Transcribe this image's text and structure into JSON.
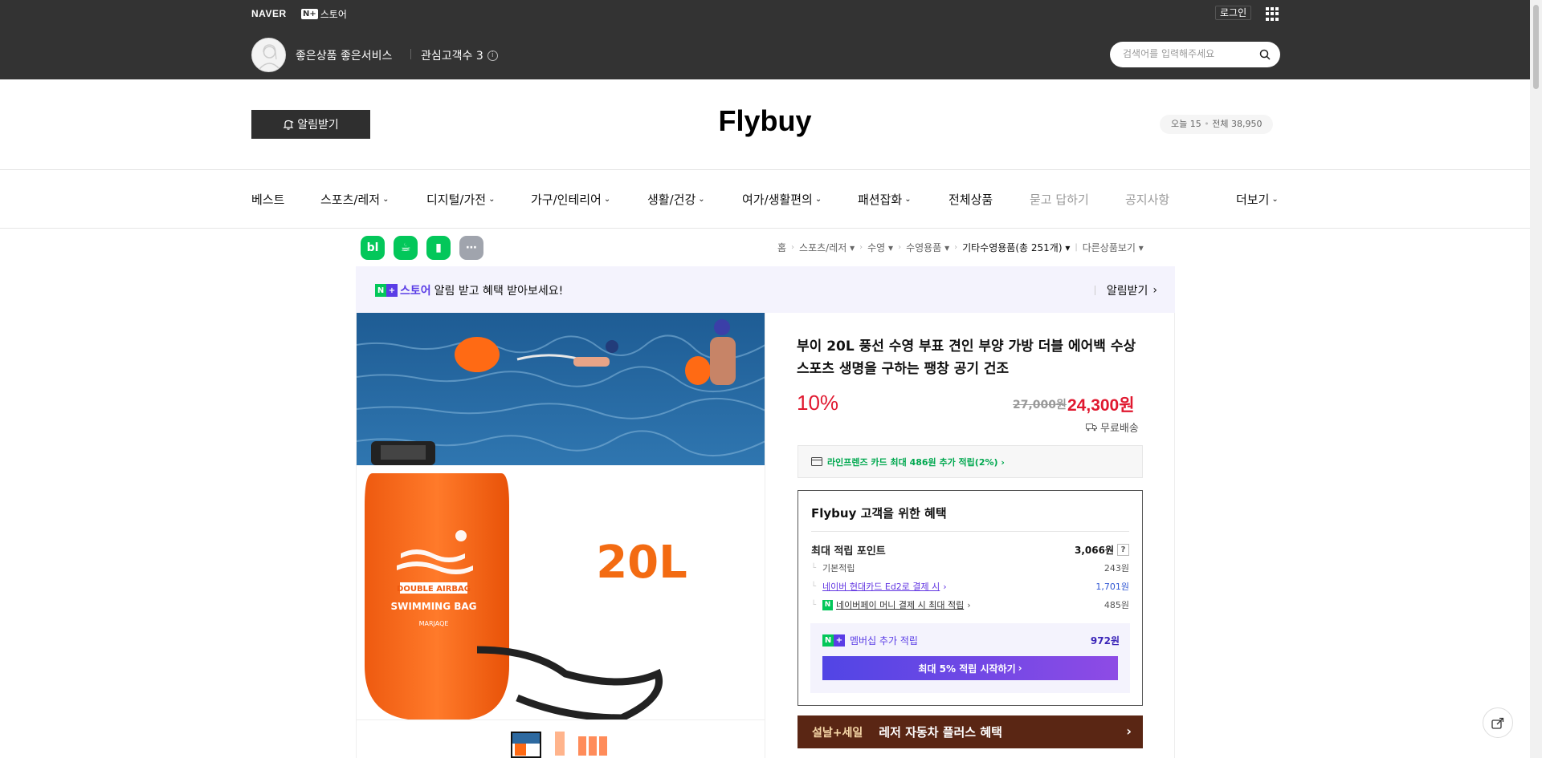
{
  "header": {
    "naver_logo": "NAVER",
    "nplus_badge": "N+",
    "nplus_store_label": "스토어",
    "login_label": "로그인",
    "store_tagline": "좋은상품 좋은서비스",
    "follower_label": "관심고객수 3",
    "search_placeholder": "검색어를 입력해주세요"
  },
  "store": {
    "alarm_label": "알림받기",
    "title": "Flybuy",
    "visit_today": "오늘 15",
    "visit_total": "전체 38,950"
  },
  "nav": {
    "items": [
      {
        "label": "베스트"
      },
      {
        "label": "스포츠/레저"
      },
      {
        "label": "디지털/가전"
      },
      {
        "label": "가구/인테리어"
      },
      {
        "label": "생활/건강"
      },
      {
        "label": "여가/생활편의"
      },
      {
        "label": "패션잡화"
      },
      {
        "label": "전체상품"
      },
      {
        "label": "묻고 답하기"
      },
      {
        "label": "공지사항"
      },
      {
        "label": "더보기"
      }
    ]
  },
  "share": {
    "blog": "bl",
    "cafe": "☕",
    "bookmark": "▮",
    "more": "⋯"
  },
  "breadcrumb": {
    "home": "홈",
    "cat1": "스포츠/레저",
    "cat2": "수영",
    "cat3": "수영용품",
    "cat4": "기타수영용품(총 251개)",
    "other": "다른상품보기"
  },
  "promo": {
    "badge": "N+",
    "store": "스토어",
    "text": "알림 받고 혜택 받아보세요!",
    "cta": "알림받기"
  },
  "product": {
    "title": "부이 20L 풍선 수영 부표 견인 부양 가방 더블 에어백 수상 스포츠 생명을 구하는 팽창 공기 건조",
    "discount": "10%",
    "original_price": "27,000원",
    "sale_price": "24,300원",
    "shipping": "무료배송",
    "image_text": "20L",
    "bag_text_1": "DOUBLE AIRBAG",
    "bag_text_2": "SWIMMING BAG",
    "bag_brand": "MARJAQE"
  },
  "card_offer": "라인프렌즈 카드 최대 486원 추가 적립(2%) ›",
  "benefit": {
    "title": "Flybuy 고객을 위한 혜택",
    "max_point_label": "최대 적립 포인트",
    "max_point_value": "3,066원",
    "base_label": "기본적립",
    "base_value": "243원",
    "card_label": "네이버 현대카드 Ed2로 결제 시",
    "card_value": "1,701원",
    "pay_label": "네이버페이 머니 결제 시 최대 적립",
    "pay_value": "485원",
    "member_label": "멤버십 추가 적립",
    "member_value": "972원",
    "member_cta": "최대 5% 적립 시작하기"
  },
  "event_banner": {
    "tag": "설날+세일",
    "text": "레저 자동차 플러스 혜택"
  }
}
